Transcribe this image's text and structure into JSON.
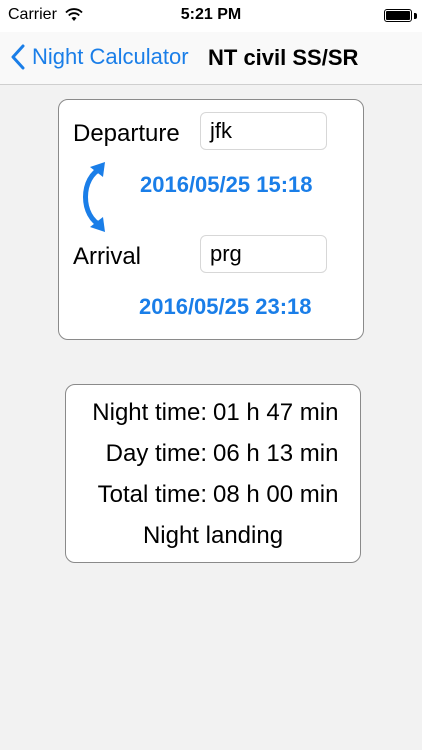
{
  "status_bar": {
    "carrier": "Carrier",
    "time": "5:21 PM"
  },
  "nav": {
    "back_label": "Night Calculator",
    "title": "NT civil SS/SR"
  },
  "route": {
    "departure_label": "Departure",
    "departure_value": "jfk",
    "departure_time": "2016/05/25 15:18",
    "arrival_label": "Arrival",
    "arrival_value": "prg",
    "arrival_time": "2016/05/25 23:18"
  },
  "results": {
    "night_label": "Night time:",
    "night_value": "01 h 47 min",
    "day_label": "Day time:",
    "day_value": "06 h 13 min",
    "total_label": "Total time:",
    "total_value": "08 h 00 min",
    "landing": "Night landing"
  },
  "colors": {
    "accent": "#1a7ee8",
    "background": "#f2f2f2",
    "card_border": "#8a8a8a"
  },
  "icons": {
    "back": "chevron-left-icon",
    "swap": "swap-arrows-icon",
    "wifi": "wifi-icon",
    "battery": "battery-icon"
  }
}
